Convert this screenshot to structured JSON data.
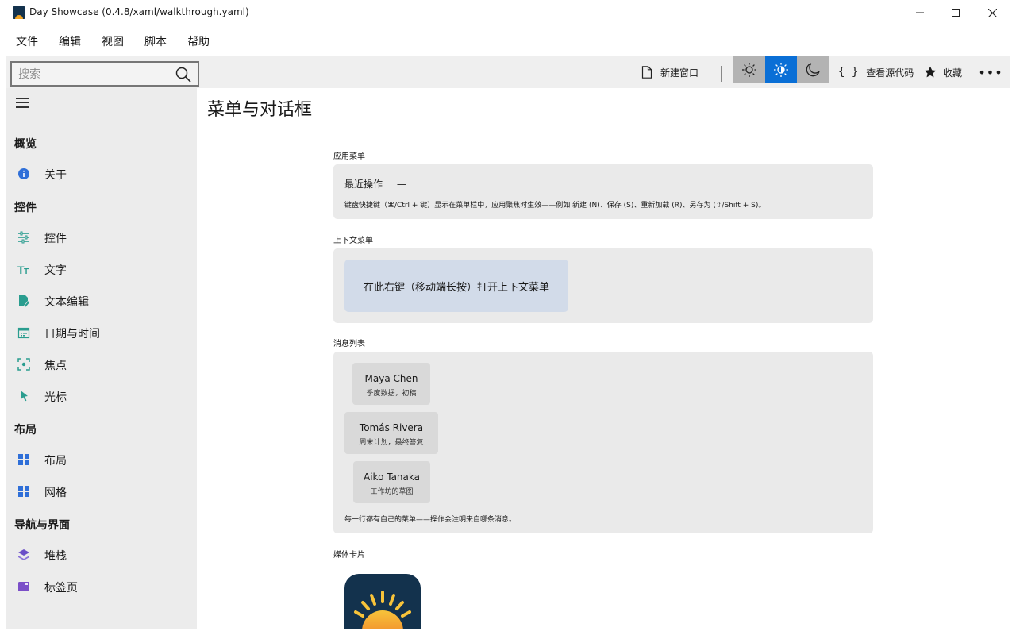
{
  "window": {
    "title": "Day Showcase (0.4.8/xaml/walkthrough.yaml)",
    "minimize": "—",
    "maximize": "☐",
    "close": "✕"
  },
  "menu": [
    "文件",
    "编辑",
    "视图",
    "脚本",
    "帮助"
  ],
  "toolbar": {
    "search_placeholder": "搜索",
    "new_window": "新建窗口",
    "view_source": "查看源代码",
    "favorite": "收藏",
    "more": "•••",
    "accent": "#0a6fd6"
  },
  "sidebar": {
    "sections": [
      {
        "title": "概览",
        "items": [
          {
            "label": "关于",
            "icon": "info-icon"
          }
        ]
      },
      {
        "title": "控件",
        "items": [
          {
            "label": "控件",
            "icon": "sliders-icon"
          },
          {
            "label": "文字",
            "icon": "text-size-icon"
          },
          {
            "label": "文本编辑",
            "icon": "edit-document-icon"
          },
          {
            "label": "日期与时间",
            "icon": "calendar-icon"
          },
          {
            "label": "焦点",
            "icon": "focus-icon"
          },
          {
            "label": "光标",
            "icon": "cursor-icon"
          }
        ]
      },
      {
        "title": "布局",
        "items": [
          {
            "label": "布局",
            "icon": "layout-grid-icon"
          },
          {
            "label": "网格",
            "icon": "grid-icon"
          }
        ]
      },
      {
        "title": "导航与界面",
        "items": [
          {
            "label": "堆栈",
            "icon": "stack-icon"
          },
          {
            "label": "标签页",
            "icon": "tabs-icon"
          }
        ]
      }
    ]
  },
  "page": {
    "title": "菜单与对话框",
    "app_menu": {
      "caption": "应用菜单",
      "recent_label": "最近操作",
      "recent_value": "—",
      "hint": "键盘快捷键（⌘/Ctrl + 键）显示在菜单栏中，应用聚焦时生效——例如 新建 (N)、保存 (S)、重新加载 (R)、另存为 (⇧/Shift + S)。"
    },
    "context_menu": {
      "caption": "上下文菜单",
      "target": "在此右键（移动端长按）打开上下文菜单"
    },
    "message_list": {
      "caption": "消息列表",
      "messages": [
        {
          "name": "Maya Chen",
          "preview": "季度数据，初稿"
        },
        {
          "name": "Tomás Rivera",
          "preview": "周末计划，最终答复"
        },
        {
          "name": "Aiko Tanaka",
          "preview": "工作坊的草图"
        }
      ],
      "note": "每一行都有自己的菜单——操作会注明来自哪条消息。"
    },
    "media_card": {
      "caption": "媒体卡片"
    }
  }
}
